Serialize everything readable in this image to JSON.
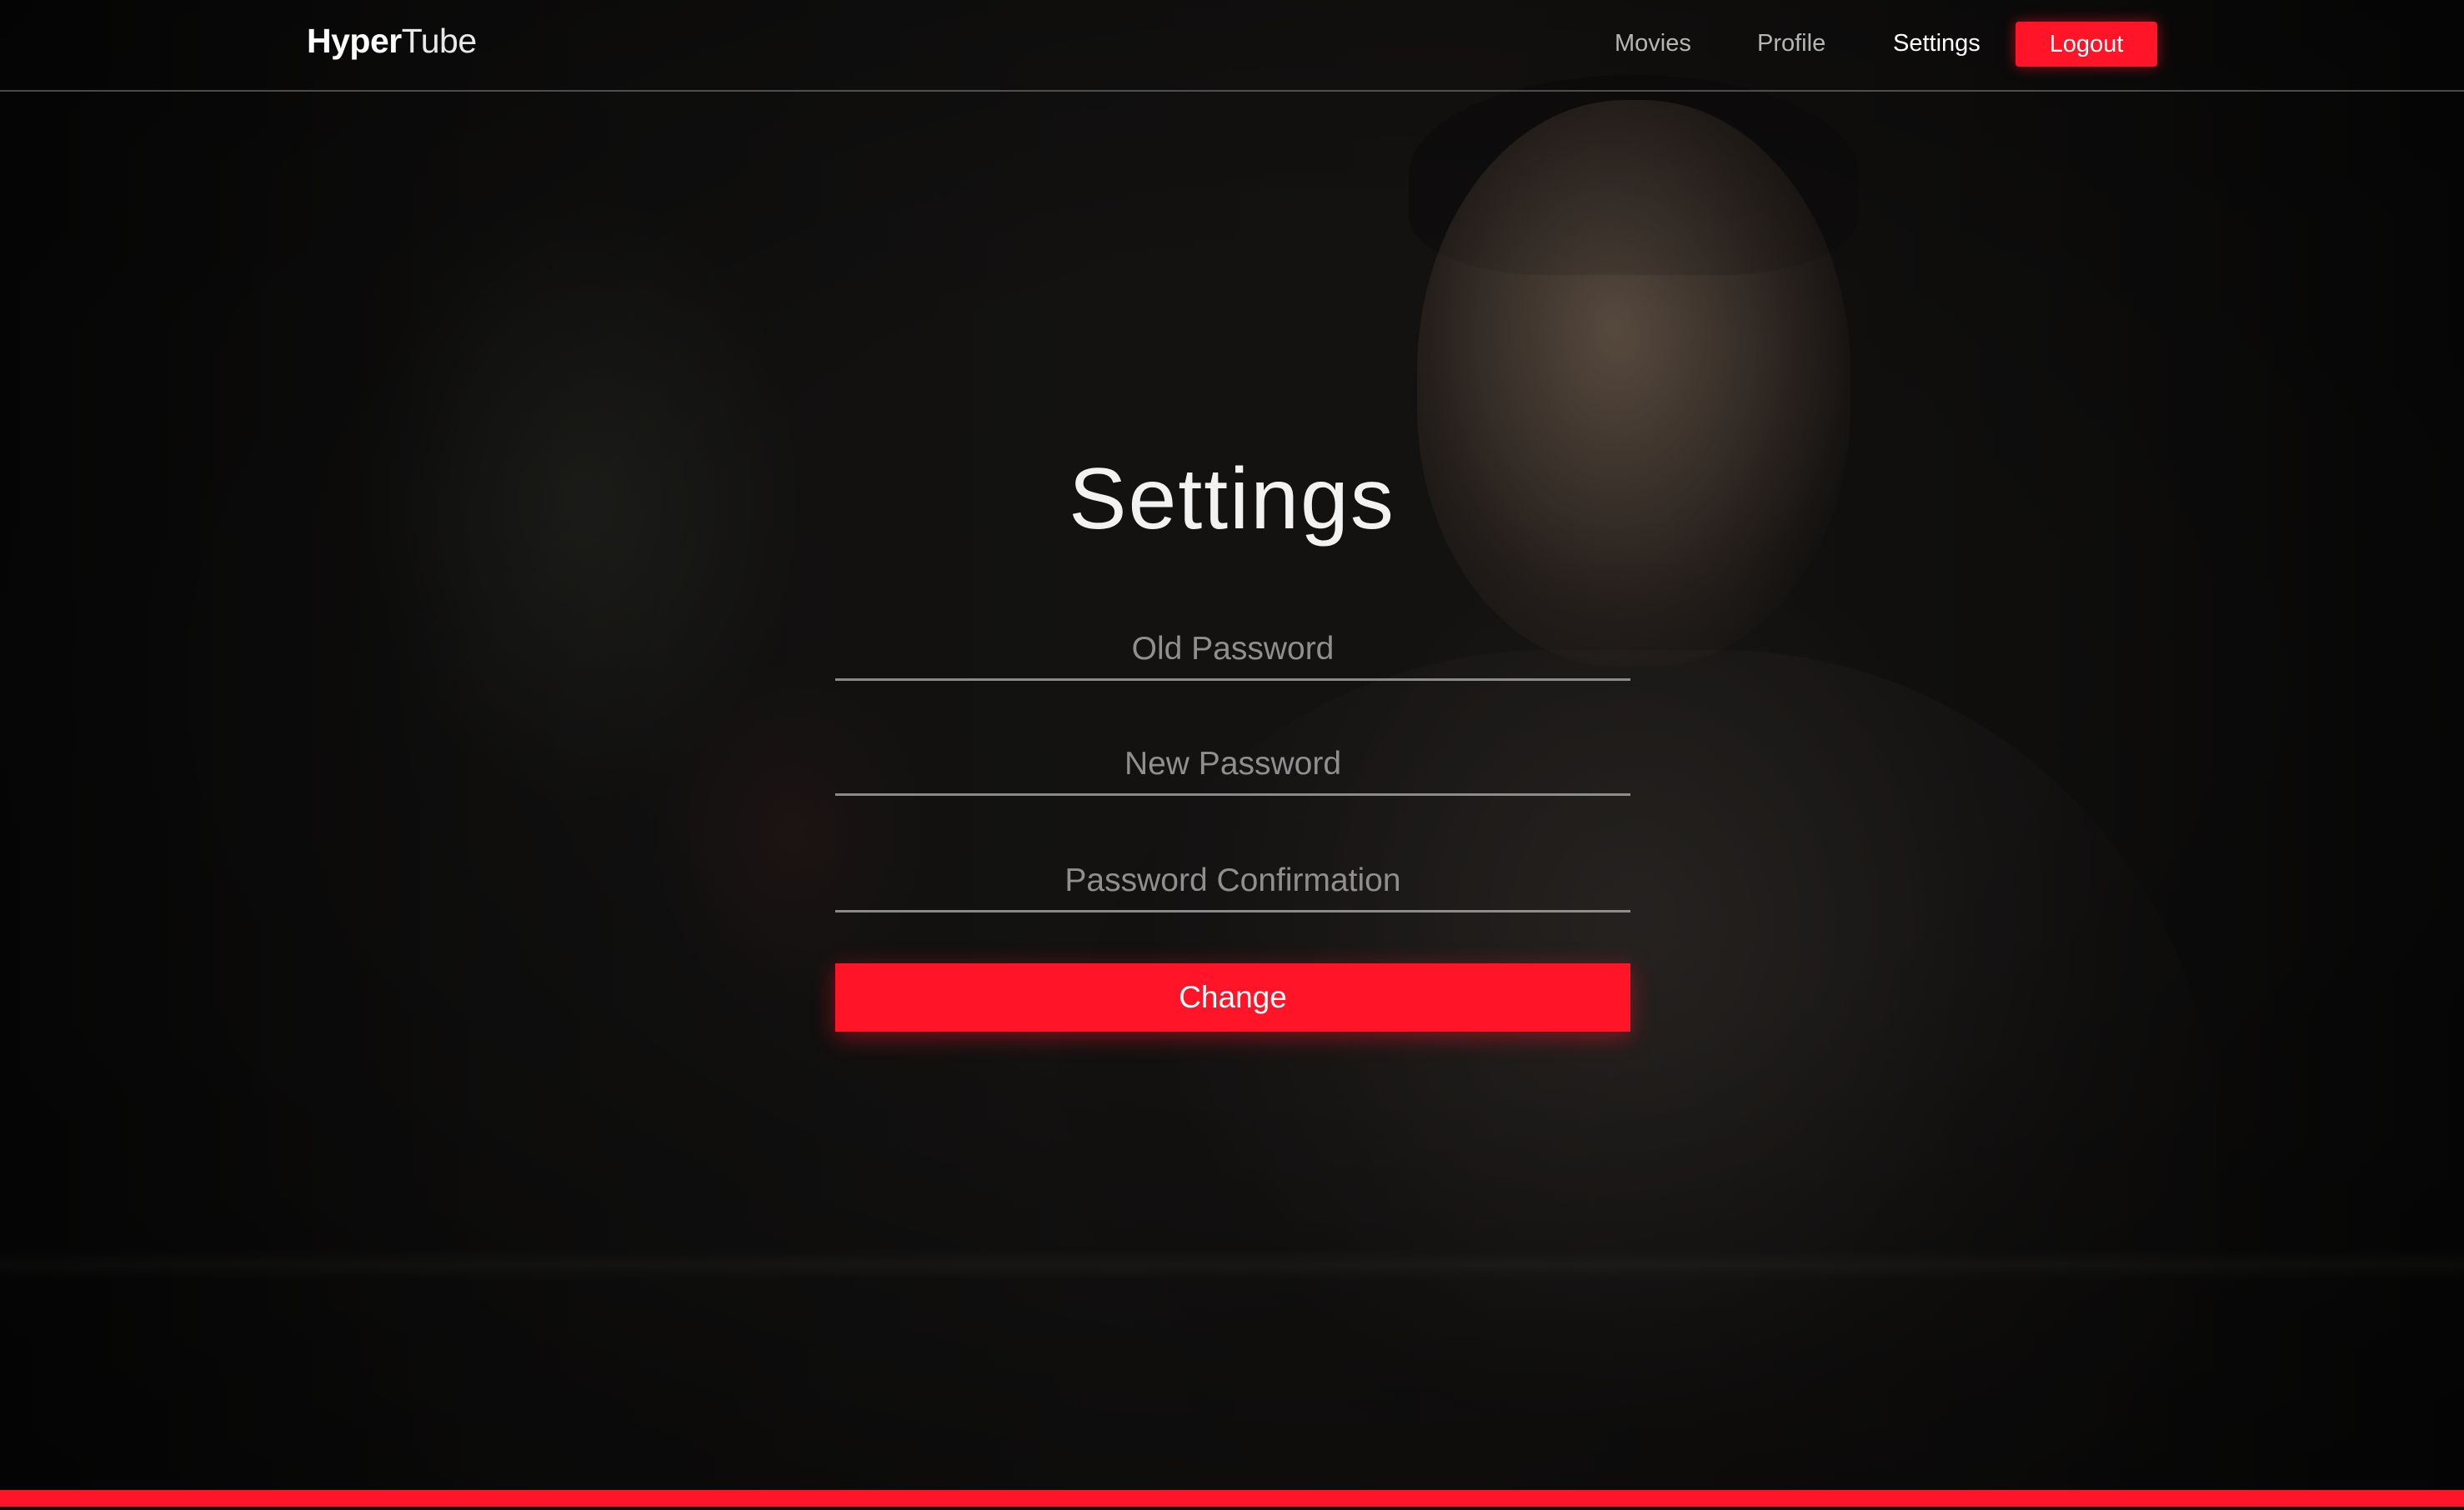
{
  "navbar": {
    "brand_bold": "Hyper",
    "brand_light": "Tube",
    "links": [
      {
        "label": "Movies"
      },
      {
        "label": "Profile"
      },
      {
        "label": "Settings"
      }
    ],
    "logout_label": "Logout"
  },
  "settings": {
    "title": "Settings",
    "old_password_placeholder": "Old Password",
    "new_password_placeholder": "New Password",
    "confirm_password_placeholder": "Password Confirmation",
    "submit_label": "Change"
  },
  "colors": {
    "accent": "#ff1428",
    "text": "#ffffff",
    "muted_text": "#b5b5b5",
    "placeholder": "#8f8f8f"
  }
}
